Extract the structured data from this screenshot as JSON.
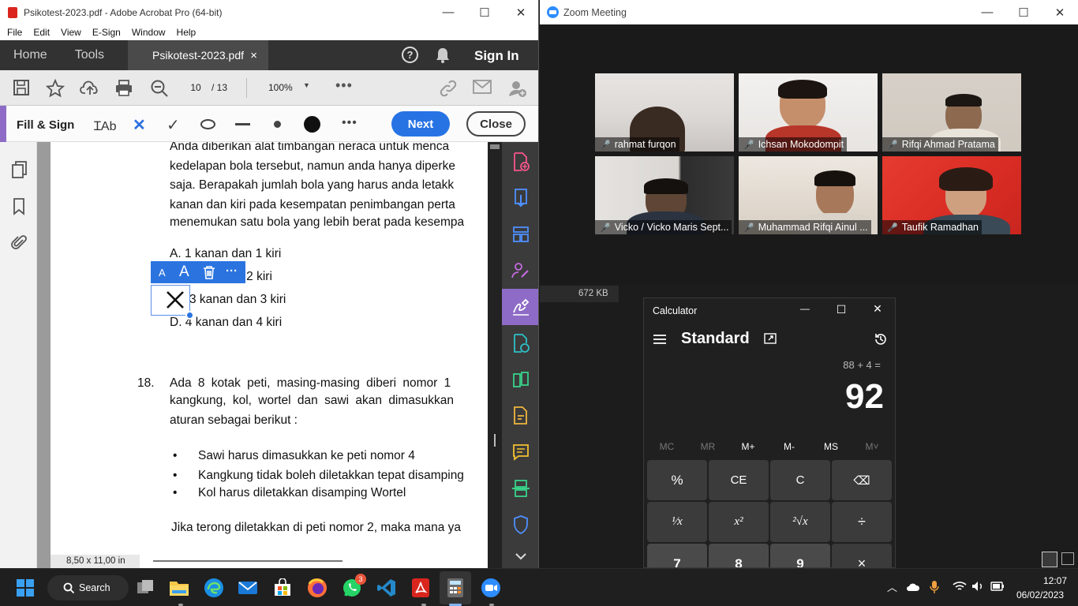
{
  "acrobat": {
    "title": "Psikotest-2023.pdf - Adobe Acrobat Pro (64-bit)",
    "menu": [
      "File",
      "Edit",
      "View",
      "E-Sign",
      "Window",
      "Help"
    ],
    "tabs": {
      "home": "Home",
      "tools": "Tools",
      "doc": "Psikotest-2023.pdf",
      "close": "×"
    },
    "sign_in": "Sign In",
    "page_current": "10",
    "page_total": "/ 13",
    "zoom": "100%",
    "fill_sign_label": "Fill & Sign",
    "next_label": "Next",
    "close_label": "Close",
    "page_size": "8,50 x 11,00 in",
    "annotation_toolbar": {
      "small_a": "A",
      "big_a": "A",
      "more": "···"
    },
    "document": {
      "paragraph": [
        "Anda diberikan alat timbangan neraca untuk menca",
        "kedelapan bola tersebut, namun anda hanya diperke",
        "saja. Berapakah jumlah bola yang harus anda letakk",
        "kanan dan kiri pada kesempatan penimbangan perta",
        "menemukan satu bola yang lebih berat pada kesempa"
      ],
      "options": [
        "A.  1 kanan dan 1 kiri",
        "dan 2 kiri",
        "3 kanan dan 3 kiri",
        "D.  4 kanan dan 4 kiri"
      ],
      "q18_number": "18.",
      "q18_lines": [
        "Ada 8 kotak peti, masing-masing diberi nomor 1",
        "kangkung, kol, wortel dan sawi akan dimasukkan",
        "aturan sebagai berikut :"
      ],
      "bullets": [
        "Sawi harus dimasukkan ke peti nomor 4",
        "Kangkung tidak boleh diletakkan tepat disamping",
        "Kol harus diletakkan disamping Wortel"
      ],
      "question": "Jika terong diletakkan di peti nomor 2, maka mana ya"
    }
  },
  "zoom": {
    "title": "Zoom Meeting",
    "participants": [
      {
        "name": "rahmat furqon"
      },
      {
        "name": "Ichsan Mokodompit"
      },
      {
        "name": "Rifqi Ahmad Pratama"
      },
      {
        "name": "Vicko / Vicko Maris Sept..."
      },
      {
        "name": "Muhammad Rifqi Ainul ..."
      },
      {
        "name": "Taufik Ramadhan"
      }
    ],
    "file_size": "672 KB"
  },
  "calculator": {
    "title": "Calculator",
    "mode": "Standard",
    "expression": "88 + 4 =",
    "display": "92",
    "memory": [
      "MC",
      "MR",
      "M+",
      "M-",
      "MS",
      "M˅"
    ],
    "keys": [
      "%",
      "CE",
      "C",
      "⌫",
      "¹⁄x",
      "x²",
      "²√x",
      "÷",
      "7",
      "8",
      "9",
      "×"
    ]
  },
  "taskbar": {
    "search": "Search",
    "whatsapp_badge": "3",
    "time": "12:07",
    "date": "06/02/2023"
  }
}
